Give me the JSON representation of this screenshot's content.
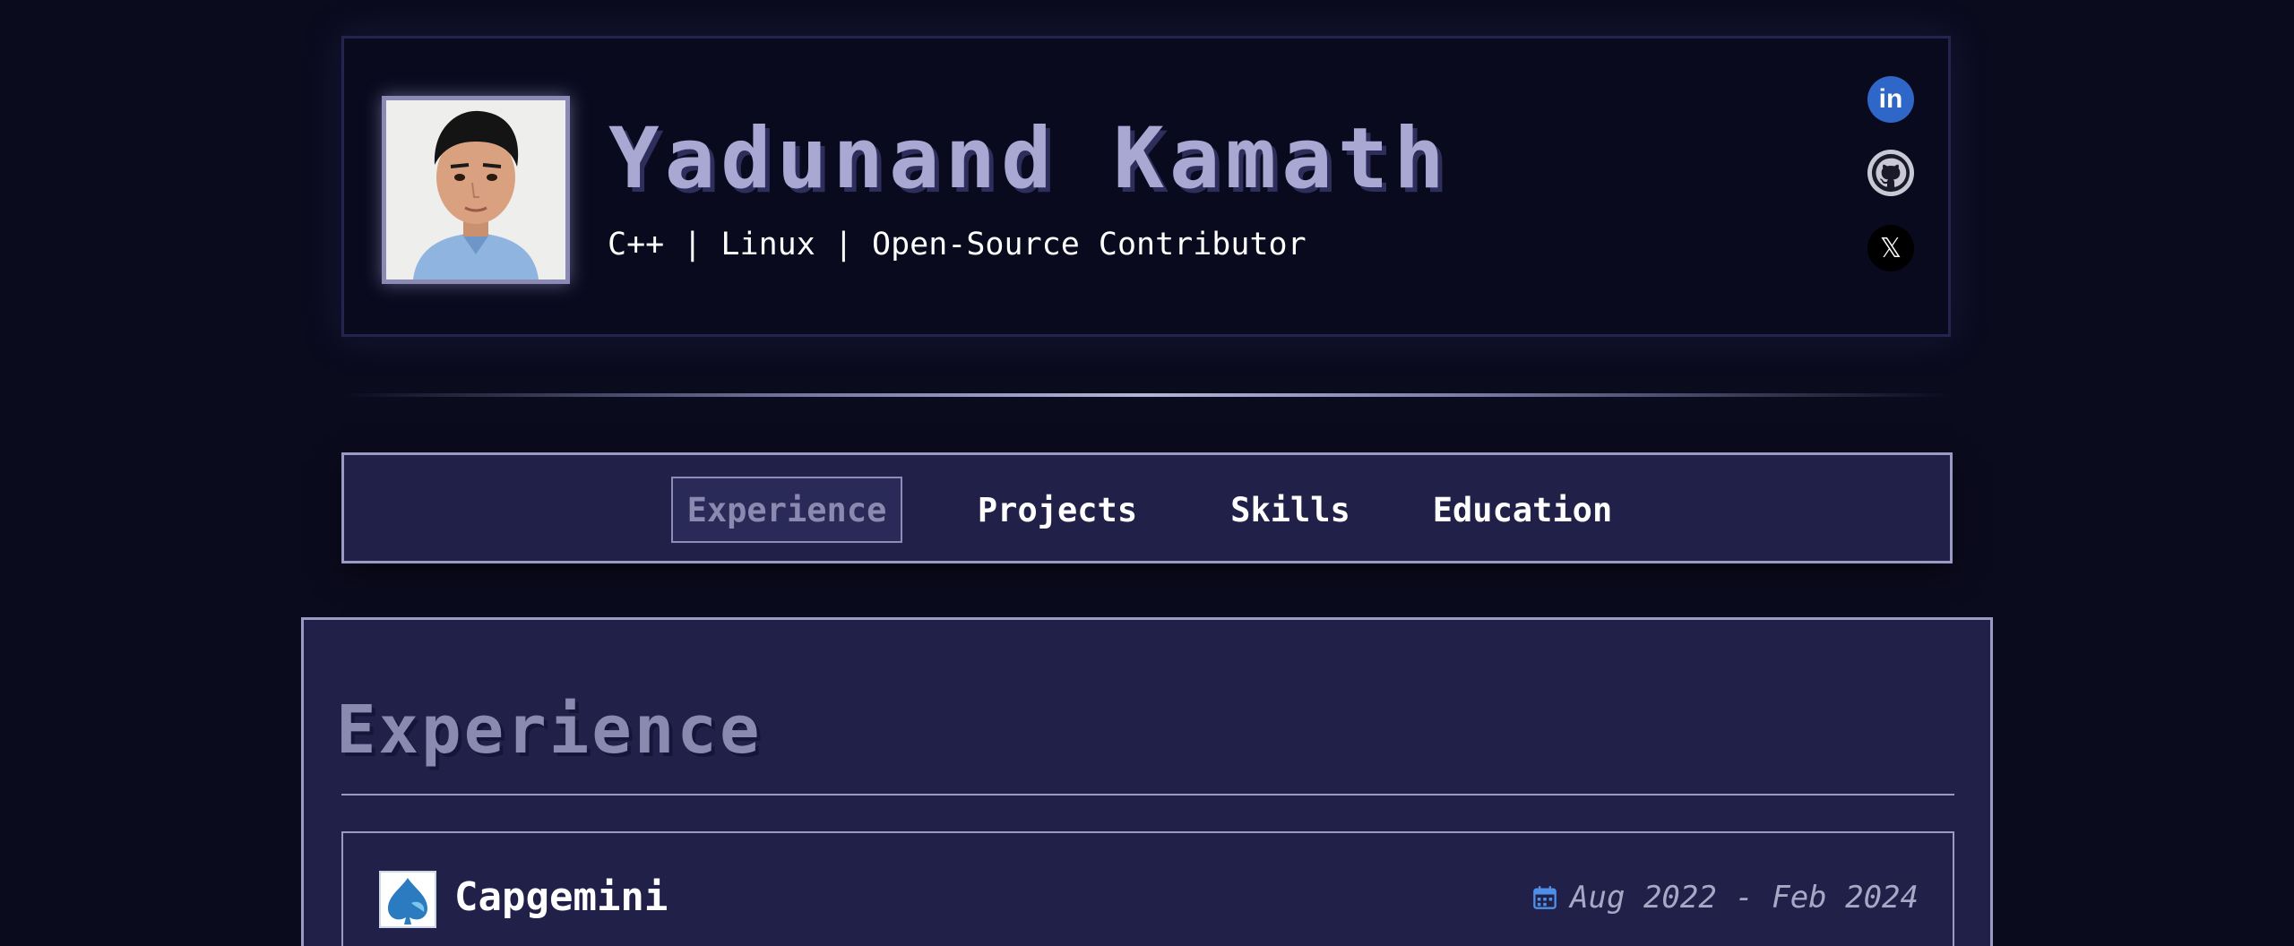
{
  "profile": {
    "name": "Yadunand Kamath",
    "tagline": "C++ | Linux | Open-Source Contributor"
  },
  "social": [
    {
      "icon": "linkedin-icon",
      "label": "in",
      "color": "#2f67c8"
    },
    {
      "icon": "github-icon",
      "color": "#c9c9d6"
    },
    {
      "icon": "x-twitter-icon",
      "label": "𝕏",
      "color": "#000000"
    }
  ],
  "nav": {
    "tabs": [
      {
        "label": "Experience",
        "active": true
      },
      {
        "label": "Projects",
        "active": false
      },
      {
        "label": "Skills",
        "active": false
      },
      {
        "label": "Education",
        "active": false
      }
    ]
  },
  "section": {
    "title": "Experience",
    "jobs": [
      {
        "company": "Capgemini",
        "dates": "Aug 2022 - Feb 2024"
      }
    ]
  },
  "colors": {
    "background": "#0b0b1e",
    "panel": "#212049",
    "accent": "#a8a8d2",
    "border": "#9a9ac4"
  }
}
